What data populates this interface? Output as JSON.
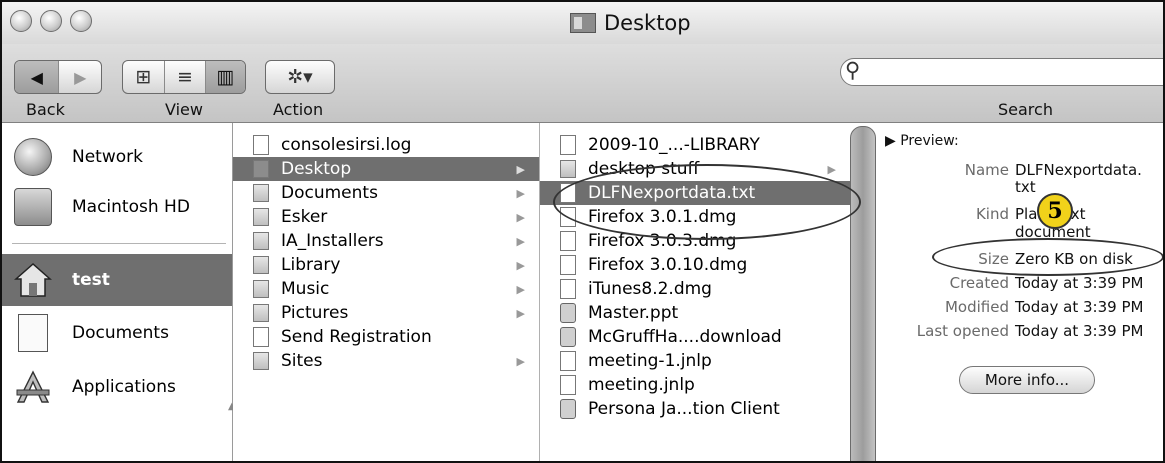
{
  "window": {
    "title": "Desktop"
  },
  "toolbar": {
    "back_label": "Back",
    "view_label": "View",
    "action_label": "Action",
    "search_label": "Search",
    "search_value": "",
    "back_arrow": "◀",
    "forward_arrow": "▶",
    "view_icon": "⊞",
    "list_icon": "≡",
    "column_icon": "▥",
    "action_glyph": "✲▾",
    "search_icon": "🔍"
  },
  "sidebar": {
    "items": [
      {
        "label": "Network",
        "icon": "globe-icon"
      },
      {
        "label": "Macintosh HD",
        "icon": "hard-drive-icon"
      },
      {
        "label": "test",
        "icon": "home-icon",
        "selected": true
      },
      {
        "label": "Documents",
        "icon": "document-icon"
      },
      {
        "label": "Applications",
        "icon": "applications-icon"
      }
    ]
  },
  "column1": {
    "items": [
      {
        "name": "consolesirsi.log",
        "kind": "document",
        "has_children": false
      },
      {
        "name": "Desktop",
        "kind": "folder",
        "has_children": true,
        "selected": true
      },
      {
        "name": "Documents",
        "kind": "folder",
        "has_children": true
      },
      {
        "name": "Esker",
        "kind": "folder",
        "has_children": true
      },
      {
        "name": "IA_Installers",
        "kind": "folder",
        "has_children": true
      },
      {
        "name": "Library",
        "kind": "folder",
        "has_children": true
      },
      {
        "name": "Music",
        "kind": "folder",
        "has_children": true
      },
      {
        "name": "Pictures",
        "kind": "folder",
        "has_children": true
      },
      {
        "name": "Send Registration",
        "kind": "alias",
        "has_children": false
      },
      {
        "name": "Sites",
        "kind": "folder",
        "has_children": true
      }
    ]
  },
  "column2": {
    "items": [
      {
        "name": "2009-10_...-LIBRARY",
        "kind": "document",
        "has_children": false
      },
      {
        "name": "desktop stuff",
        "kind": "folder",
        "has_children": true
      },
      {
        "name": "DLFNexportdata.txt",
        "kind": "document",
        "has_children": false,
        "selected": true
      },
      {
        "name": "Firefox 3.0.1.dmg",
        "kind": "disk-image",
        "has_children": false
      },
      {
        "name": "Firefox 3.0.3.dmg",
        "kind": "disk-image",
        "has_children": false
      },
      {
        "name": "Firefox 3.0.10.dmg",
        "kind": "disk-image",
        "has_children": false
      },
      {
        "name": "iTunes8.2.dmg",
        "kind": "disk-image",
        "has_children": false
      },
      {
        "name": "Master.ppt",
        "kind": "presentation",
        "has_children": false
      },
      {
        "name": "McGruffHa....download",
        "kind": "download",
        "has_children": false
      },
      {
        "name": "meeting-1.jnlp",
        "kind": "jnlp",
        "has_children": false
      },
      {
        "name": "meeting.jnlp",
        "kind": "jnlp",
        "has_children": false
      },
      {
        "name": "Persona Ja...tion Client",
        "kind": "application",
        "has_children": false
      }
    ]
  },
  "preview": {
    "heading": "▶ Preview:",
    "name_key": "Name",
    "name_value_1": "DLFNexportdata.",
    "name_value_2": "txt",
    "kind_key": "Kind",
    "kind_value_1": "Plain text",
    "kind_value_2": "document",
    "size_key": "Size",
    "size_value": "Zero KB on disk",
    "created_key": "Created",
    "created_value": "Today at 3:39 PM",
    "modified_key": "Modified",
    "modified_value": "Today at 3:39 PM",
    "opened_key": "Last opened",
    "opened_value": "Today at 3:39 PM",
    "more_info_label": "More info..."
  },
  "annotation": {
    "step_number": "5",
    "badge_color": "#f1d21a"
  }
}
